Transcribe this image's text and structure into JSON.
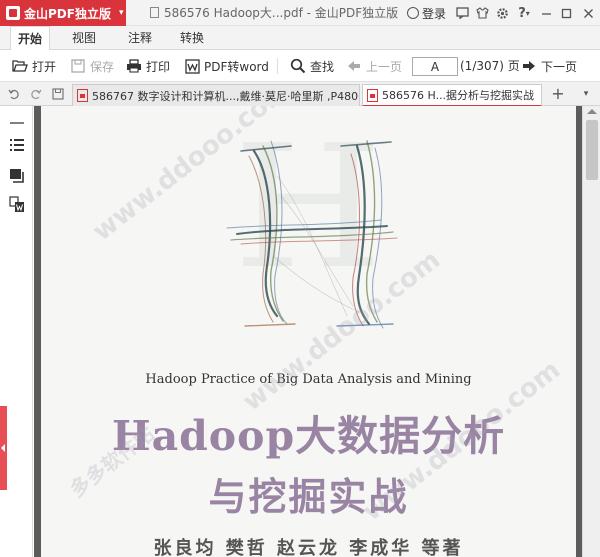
{
  "titlebar": {
    "app_name": "金山PDF独立版",
    "window_title": "586576 Hadoop大...pdf - 金山PDF独立版",
    "login": "登录",
    "help": "?"
  },
  "ribbon": {
    "tabs": [
      {
        "label": "开始",
        "active": true
      },
      {
        "label": "视图",
        "active": false
      },
      {
        "label": "注释",
        "active": false
      },
      {
        "label": "转换",
        "active": false
      }
    ]
  },
  "toolbar": {
    "open": "打开",
    "save": "保存",
    "print": "打印",
    "pdf_to_word": "PDF转word",
    "find": "查找",
    "prev_page": "上一页",
    "page_value": "A",
    "page_count": "(1/307) 页",
    "next_page": "下一页"
  },
  "doctabs": [
    {
      "label": "586767 数字设计和计算机...,戴维·莫尼·哈里斯 ,P480",
      "active": false
    },
    {
      "label": "586576 H...据分析与挖掘实战",
      "active": true
    }
  ],
  "cover": {
    "big_letter": "H",
    "english_title": "Hadoop Practice of Big Data Analysis and Mining",
    "title_line1": "Hadoop大数据分析",
    "title_line2": "与挖掘实战",
    "authors": "张良均 樊哲 赵云龙 李成华 等著"
  },
  "watermark": {
    "site": "www.ddooo.com",
    "name": "多多软件站"
  },
  "colors": {
    "brand_red": "#d9333b",
    "title_purple": "#9a84a4"
  }
}
